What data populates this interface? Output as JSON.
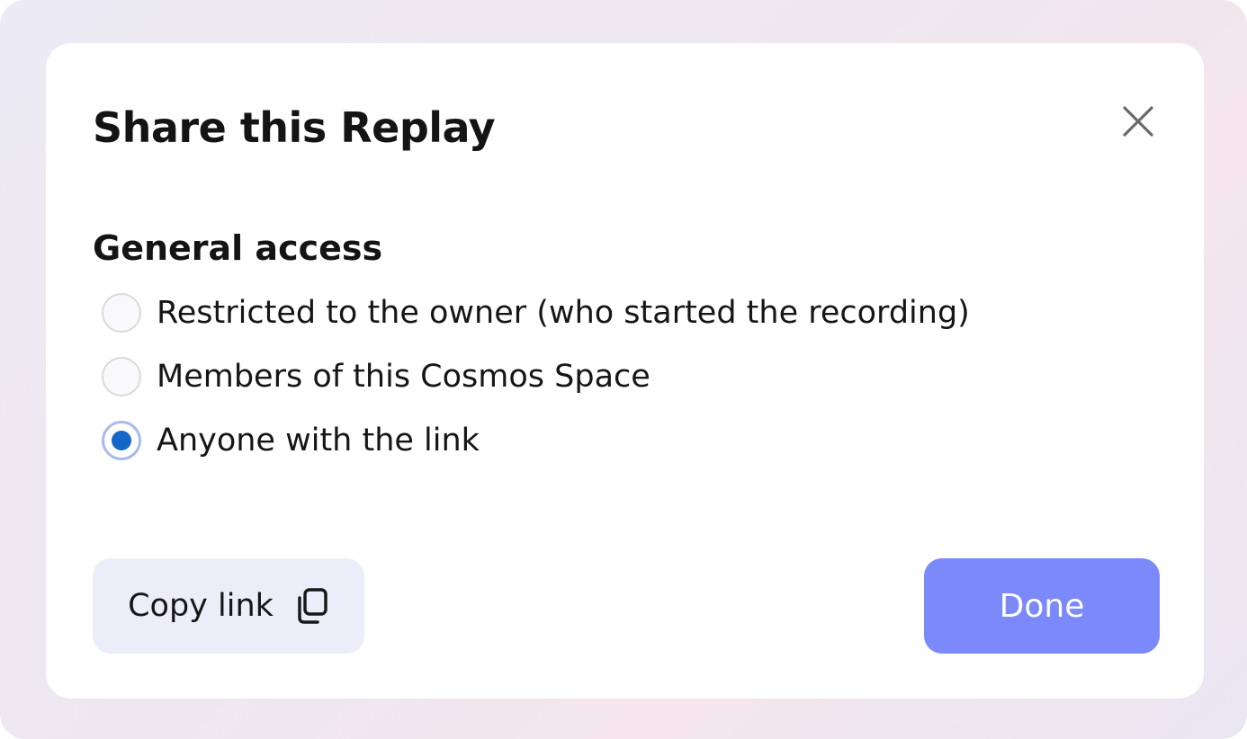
{
  "dialog": {
    "title": "Share this Replay",
    "close_icon": "close-icon"
  },
  "general_access": {
    "heading": "General access",
    "options": [
      {
        "label": "Restricted to the owner (who started the recording)",
        "selected": false
      },
      {
        "label": "Members of this Cosmos Space",
        "selected": false
      },
      {
        "label": "Anyone with the link",
        "selected": true
      }
    ]
  },
  "footer": {
    "copy_label": "Copy link",
    "copy_icon": "copy-icon",
    "done_label": "Done"
  },
  "colors": {
    "primary_button": "#7b89fa",
    "secondary_button": "#ecedf9",
    "radio_selected": "#1566c6",
    "radio_ring_selected": "#a9b8ee"
  }
}
